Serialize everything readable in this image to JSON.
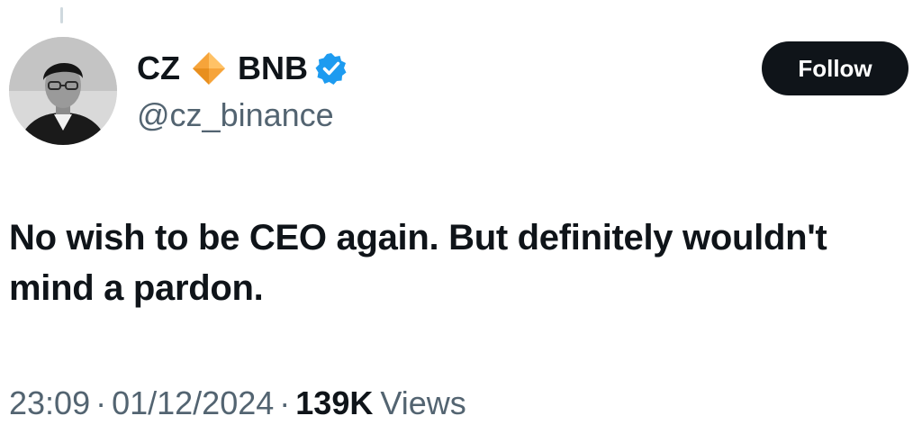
{
  "tweet": {
    "author": {
      "name": "CZ",
      "name_suffix": "BNB",
      "handle": "@cz_binance",
      "name_emoji_icon": "orange-diamond-icon",
      "verified_icon": "verified-badge-icon",
      "avatar": "profile-photo"
    },
    "follow_label": "Follow",
    "text": "No wish to be CEO again. But definitely wouldn't mind a pardon.",
    "time": "23:09",
    "date": "01/12/2024",
    "separator": "·",
    "views_count": "139K",
    "views_label": "Views"
  },
  "colors": {
    "text_primary": "#0f1419",
    "text_secondary": "#536471",
    "verified_blue": "#1d9bf0",
    "diamond_orange": "#f6a43a",
    "button_bg": "#0f1419"
  }
}
